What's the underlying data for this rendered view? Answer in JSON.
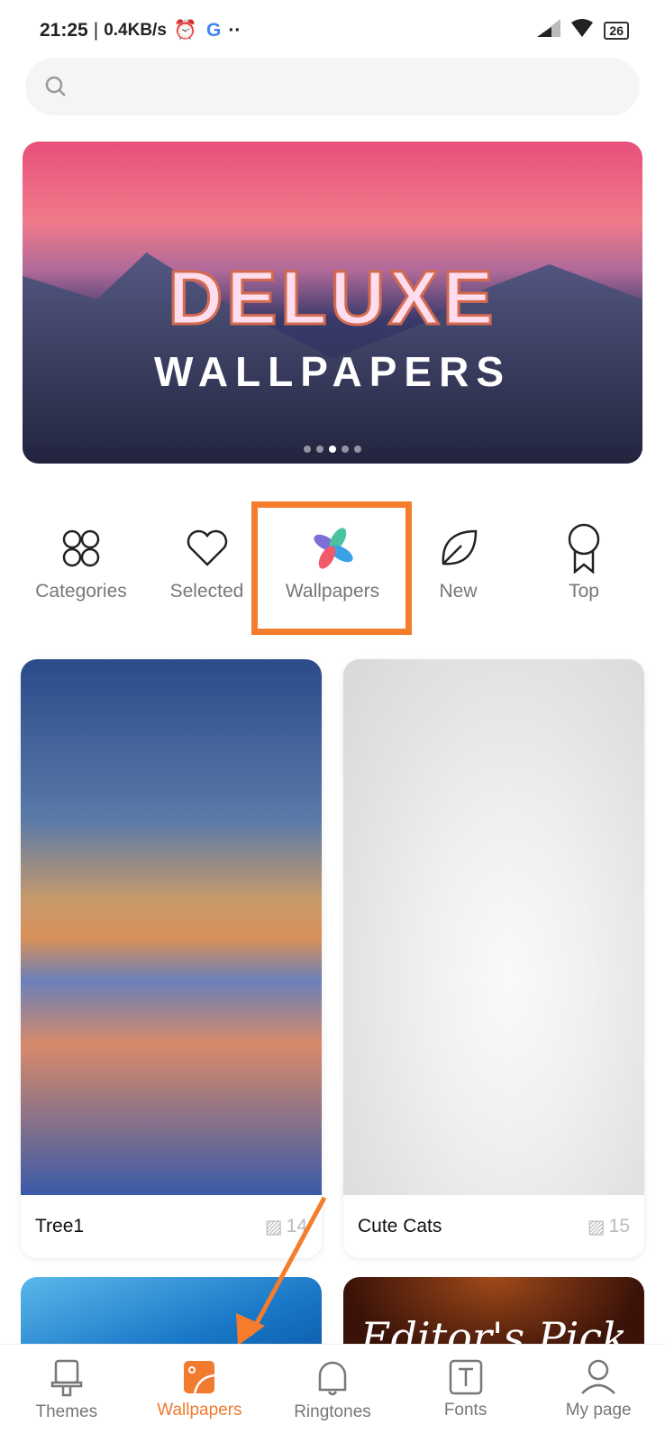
{
  "status": {
    "time": "21:25",
    "speed": "0.4KB/s",
    "battery": "26"
  },
  "search": {
    "placeholder": ""
  },
  "banner": {
    "line1": "DELUXE",
    "line2": "WALLPAPERS",
    "slides": 5,
    "active_slide": 3
  },
  "categories": [
    {
      "label": "Categories",
      "icon": "four-petal-icon"
    },
    {
      "label": "Selected",
      "icon": "heart-icon"
    },
    {
      "label": "Wallpapers",
      "icon": "pinwheel-icon"
    },
    {
      "label": "New",
      "icon": "leaf-icon"
    },
    {
      "label": "Top",
      "icon": "award-ribbon-icon"
    }
  ],
  "cards": [
    {
      "title": "Tree1",
      "count": "14"
    },
    {
      "title": "Cute Cats",
      "count": "15"
    }
  ],
  "partial_cards": [
    {
      "text": ""
    },
    {
      "text": "Editor's Pick"
    }
  ],
  "nav": [
    {
      "label": "Themes"
    },
    {
      "label": "Wallpapers",
      "active": true
    },
    {
      "label": "Ringtones"
    },
    {
      "label": "Fonts"
    },
    {
      "label": "My page"
    }
  ],
  "colors": {
    "accent": "#f07a2e",
    "highlight_box": "#f47c2a"
  }
}
